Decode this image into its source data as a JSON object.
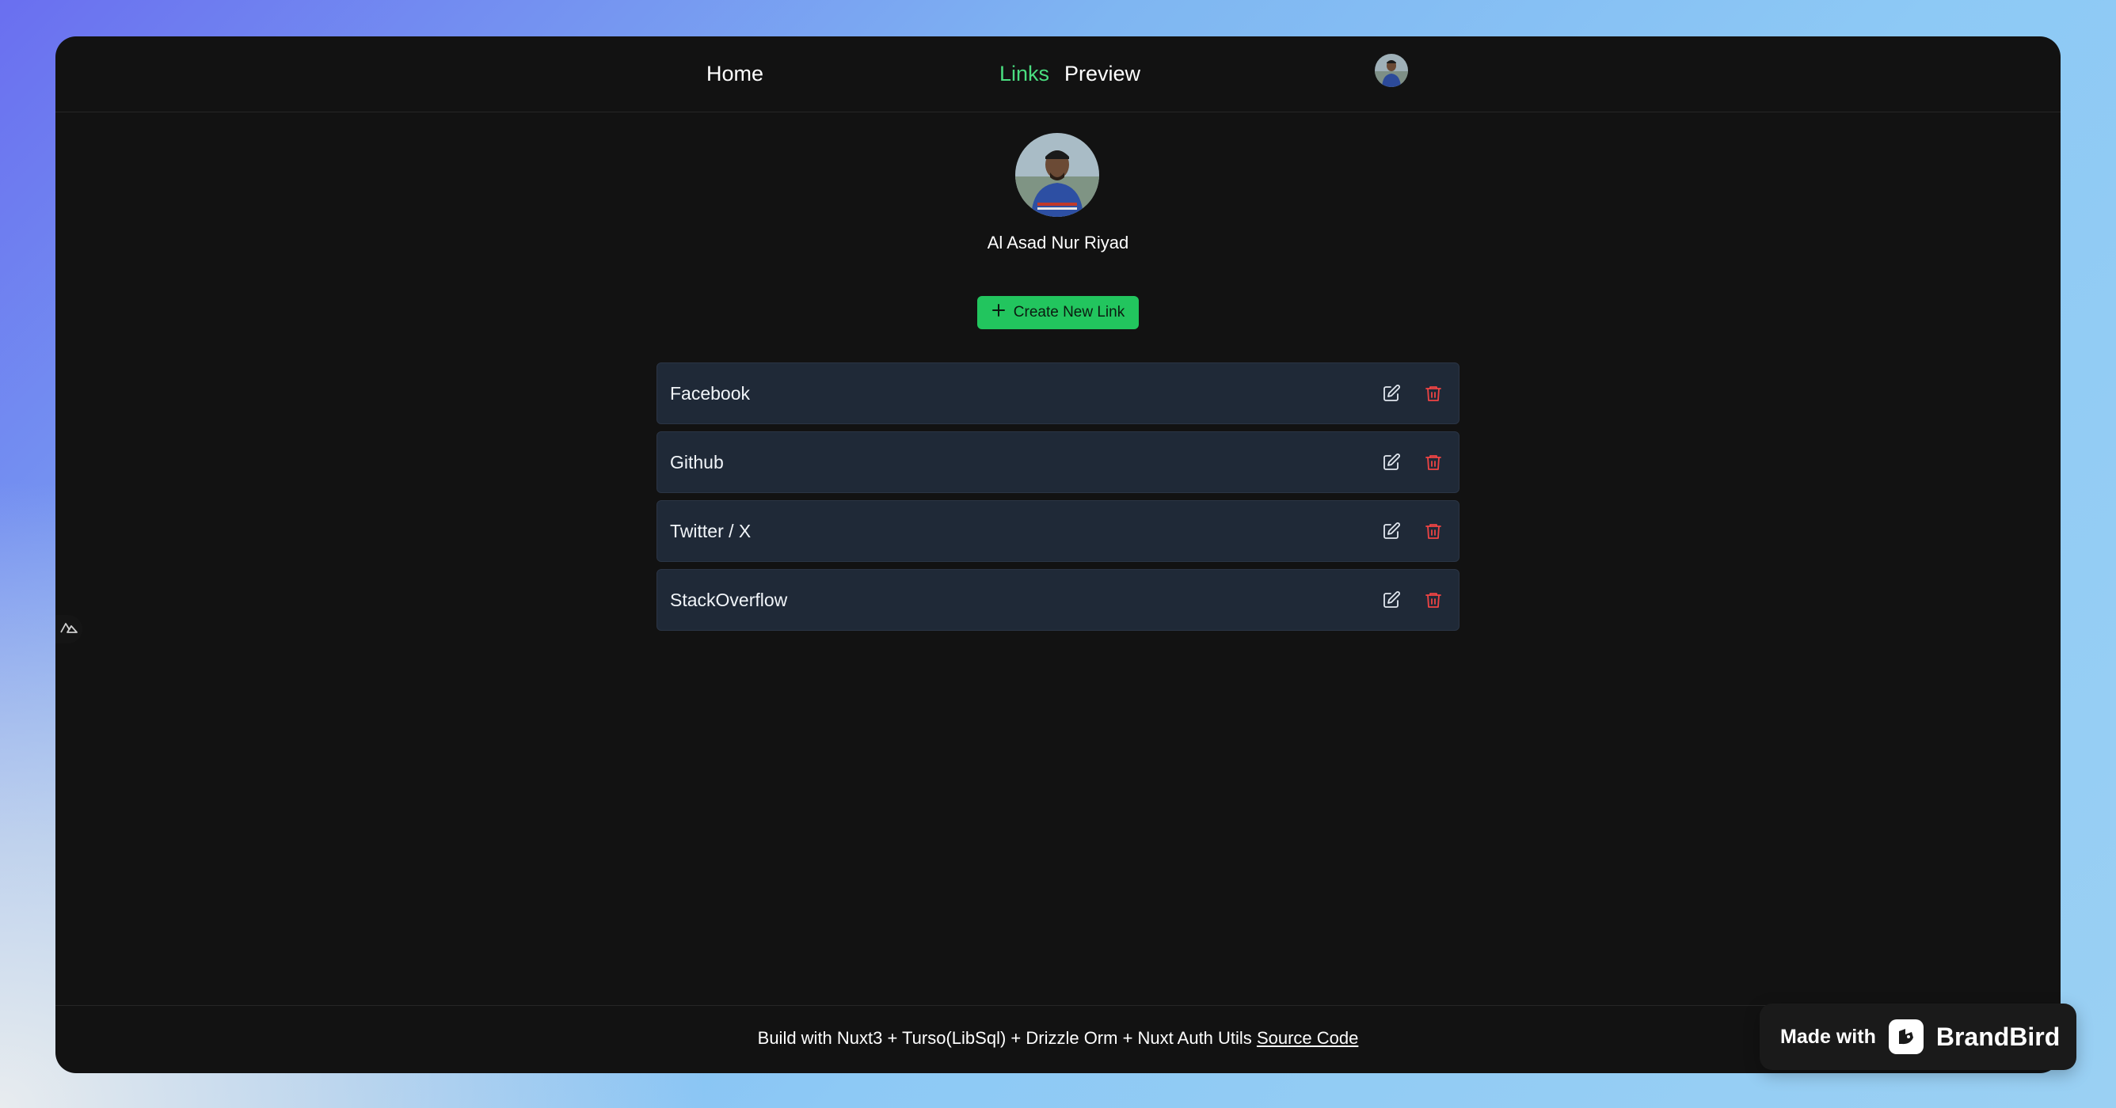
{
  "nav": {
    "home_label": "Home",
    "links_label": "Links",
    "preview_label": "Preview",
    "active_color": "#4ade80"
  },
  "profile": {
    "name": "Al Asad Nur Riyad"
  },
  "actions": {
    "create_label": "Create New Link",
    "create_icon": "plus-icon",
    "button_color": "#22c55e"
  },
  "links": [
    {
      "label": "Facebook"
    },
    {
      "label": "Github"
    },
    {
      "label": "Twitter / X"
    },
    {
      "label": "StackOverflow"
    }
  ],
  "link_icons": {
    "edit": "edit-icon",
    "delete": "trash-icon",
    "delete_color": "#ef4444"
  },
  "footer": {
    "text": "Build with Nuxt3 + Turso(LibSql) + Drizzle Orm + Nuxt Auth Utils",
    "source_link": "Source Code"
  },
  "badge": {
    "made_with": "Made with",
    "brand": "BrandBird"
  }
}
